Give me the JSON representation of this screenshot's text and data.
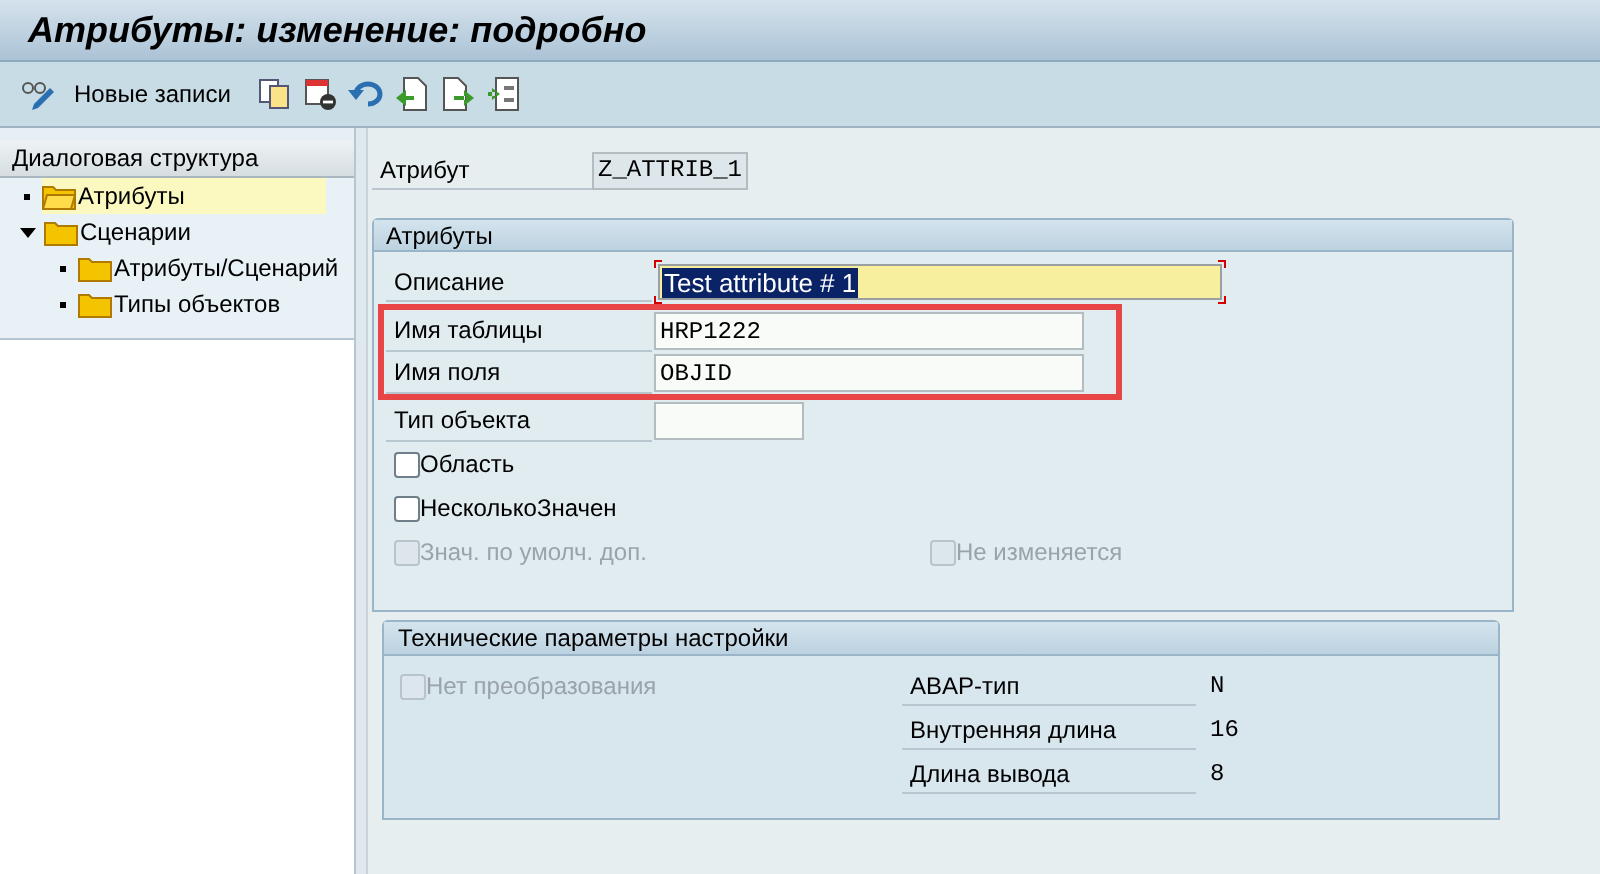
{
  "window": {
    "title": "Атрибуты: изменение: подробно"
  },
  "toolbar": {
    "new_entries": "Новые записи"
  },
  "sidebar": {
    "header": "Диалоговая структура",
    "tree": [
      {
        "label": "Атрибуты",
        "selected": true,
        "expanded": false
      },
      {
        "label": "Сценарии",
        "selected": false,
        "expanded": true,
        "children": [
          {
            "label": "Атрибуты/Сценарий",
            "selected": false,
            "expanded": false
          },
          {
            "label": "Типы объектов",
            "selected": false,
            "expanded": false
          }
        ]
      }
    ]
  },
  "attribute": {
    "label": "Атрибут",
    "value": "Z_ATTRIB_1"
  },
  "group": {
    "title": "Атрибуты",
    "fields": [
      {
        "kind": "required",
        "label": "Описание",
        "value": "Test attribute # 1",
        "highlighted": false
      },
      {
        "kind": "text",
        "label": "Имя таблицы",
        "value": "HRP1222",
        "highlighted": true
      },
      {
        "kind": "text",
        "label": "Имя поля",
        "value": "OBJID",
        "highlighted": true
      },
      {
        "kind": "short",
        "label": "Тип объекта",
        "highlighted": false
      },
      {
        "kind": "checkbox",
        "label": "Область",
        "checked": false,
        "disabled": false,
        "highlighted": false
      },
      {
        "kind": "checkbox",
        "label": "НесколькоЗначен",
        "checked": false,
        "disabled": false,
        "highlighted": false
      },
      {
        "kind": "checkbox_pair",
        "items": [
          {
            "label": "Знач. по умолч. доп.",
            "checked": false,
            "disabled": true
          },
          {
            "label": "Не изменяется",
            "checked": false,
            "disabled": true
          }
        ],
        "highlighted": false
      }
    ]
  },
  "tech": {
    "title": "Технические параметры настройки",
    "checkbox": {
      "label": "Нет преобразования",
      "checked": false,
      "disabled": true
    },
    "props": [
      {
        "label": "ABAP-тип",
        "value": "N"
      },
      {
        "label": "Внутренняя длина",
        "value": "16"
      },
      {
        "label": "Длина вывода",
        "value": "8"
      }
    ]
  }
}
